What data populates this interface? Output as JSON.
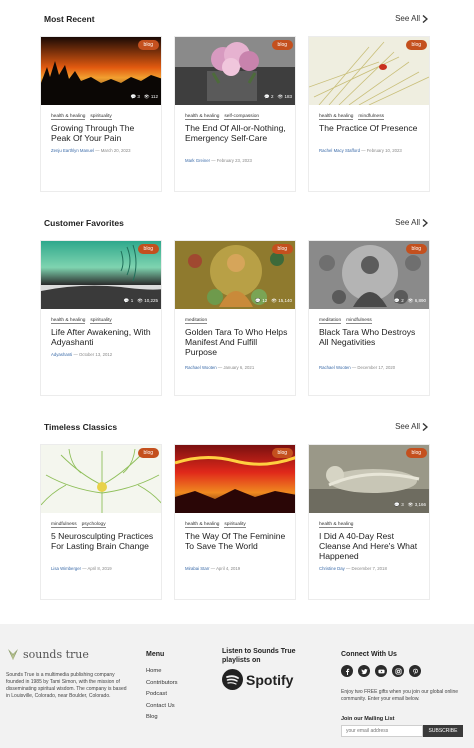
{
  "sections": [
    {
      "title": "Most Recent",
      "see_all": "See All",
      "cards": [
        {
          "badge": "blog",
          "comments": "3",
          "views": "112",
          "tags": [
            "health & healing",
            "spirituality"
          ],
          "title": "Growing Through The Peak Of Your Pain",
          "author": "Zenju Earthlyn Manuel",
          "date": "March 20, 2023"
        },
        {
          "badge": "blog",
          "comments": "2",
          "views": "183",
          "tags": [
            "health & healing",
            "self-compassion"
          ],
          "title": "The End Of All-or-Nothing, Emergency Self-Care",
          "author": "Mark Greiner",
          "date": "February 23, 2023"
        },
        {
          "badge": "blog",
          "comments": "",
          "views": "",
          "tags": [
            "health & healing",
            "mindfulness"
          ],
          "title": "The Practice Of Presence",
          "author": "Rachel Macy Stafford",
          "date": "February 10, 2023"
        }
      ]
    },
    {
      "title": "Customer Favorites",
      "see_all": "See All",
      "cards": [
        {
          "badge": "blog",
          "comments": "1",
          "views": "10,225",
          "tags": [
            "health & healing",
            "spirituality"
          ],
          "title": "Life After Awakening, With Adyashanti",
          "author": "Adyashanti",
          "date": "October 13, 2012"
        },
        {
          "badge": "blog",
          "comments": "12",
          "views": "15,140",
          "tags": [
            "meditation"
          ],
          "title": "Golden Tara To Who Helps Manifest And Fulfill Purpose",
          "author": "Rachael Wooten",
          "date": "January 6, 2021"
        },
        {
          "badge": "blog",
          "comments": "2",
          "views": "6,890",
          "tags": [
            "meditation",
            "mindfulness"
          ],
          "title": "Black Tara Who Destroys All Negativities",
          "author": "Rachael Wooten",
          "date": "December 17, 2020"
        }
      ]
    },
    {
      "title": "Timeless Classics",
      "see_all": "See All",
      "cards": [
        {
          "badge": "blog",
          "comments": "",
          "views": "",
          "tags": [
            "mindfulness",
            "psychology"
          ],
          "title": "5 Neurosculpting Practices For Lasting Brain Change",
          "author": "Lisa Wimberger",
          "date": "April 8, 2019"
        },
        {
          "badge": "blog",
          "comments": "",
          "views": "",
          "tags": [
            "health & healing",
            "spirituality"
          ],
          "title": "The Way Of The Feminine To Save The World",
          "author": "Mirabai Starr",
          "date": "April 4, 2019"
        },
        {
          "badge": "blog",
          "comments": "3",
          "views": "3,166",
          "tags": [
            "health & healing"
          ],
          "title": "I Did A 40-Day Rest Cleanse And Here's What Happened",
          "author": "Christine Day",
          "date": "December 7, 2018"
        }
      ]
    }
  ],
  "footer": {
    "logo_text": "sounds true",
    "about": "Sounds True is a multimedia publishing company founded in 1985 by Tami Simon, with the mission of disseminating spiritual wisdom. The company is based in Louisville, Colorado, near Boulder, Colorado.",
    "menu_heading": "Menu",
    "menu_items": [
      "Home",
      "Contributors",
      "Podcast",
      "Contact Us",
      "Blog"
    ],
    "playlist_heading": "Listen to Sounds True playlists on",
    "spotify_label": "Spotify",
    "connect_heading": "Connect With Us",
    "social_icons": [
      "facebook-icon",
      "twitter-icon",
      "youtube-icon",
      "instagram-icon",
      "pinterest-icon"
    ],
    "gift_text": "Enjoy two FREE gifts when you join our global online community. Enter your email below.",
    "mailing_label": "Join our Mailing List",
    "email_placeholder": "your email address",
    "subscribe_label": "SUBSCRIBE"
  },
  "colors": {
    "badge": "#c4501e",
    "author_link": "#3a6aa8",
    "footer_bg": "#f2f2f2"
  }
}
